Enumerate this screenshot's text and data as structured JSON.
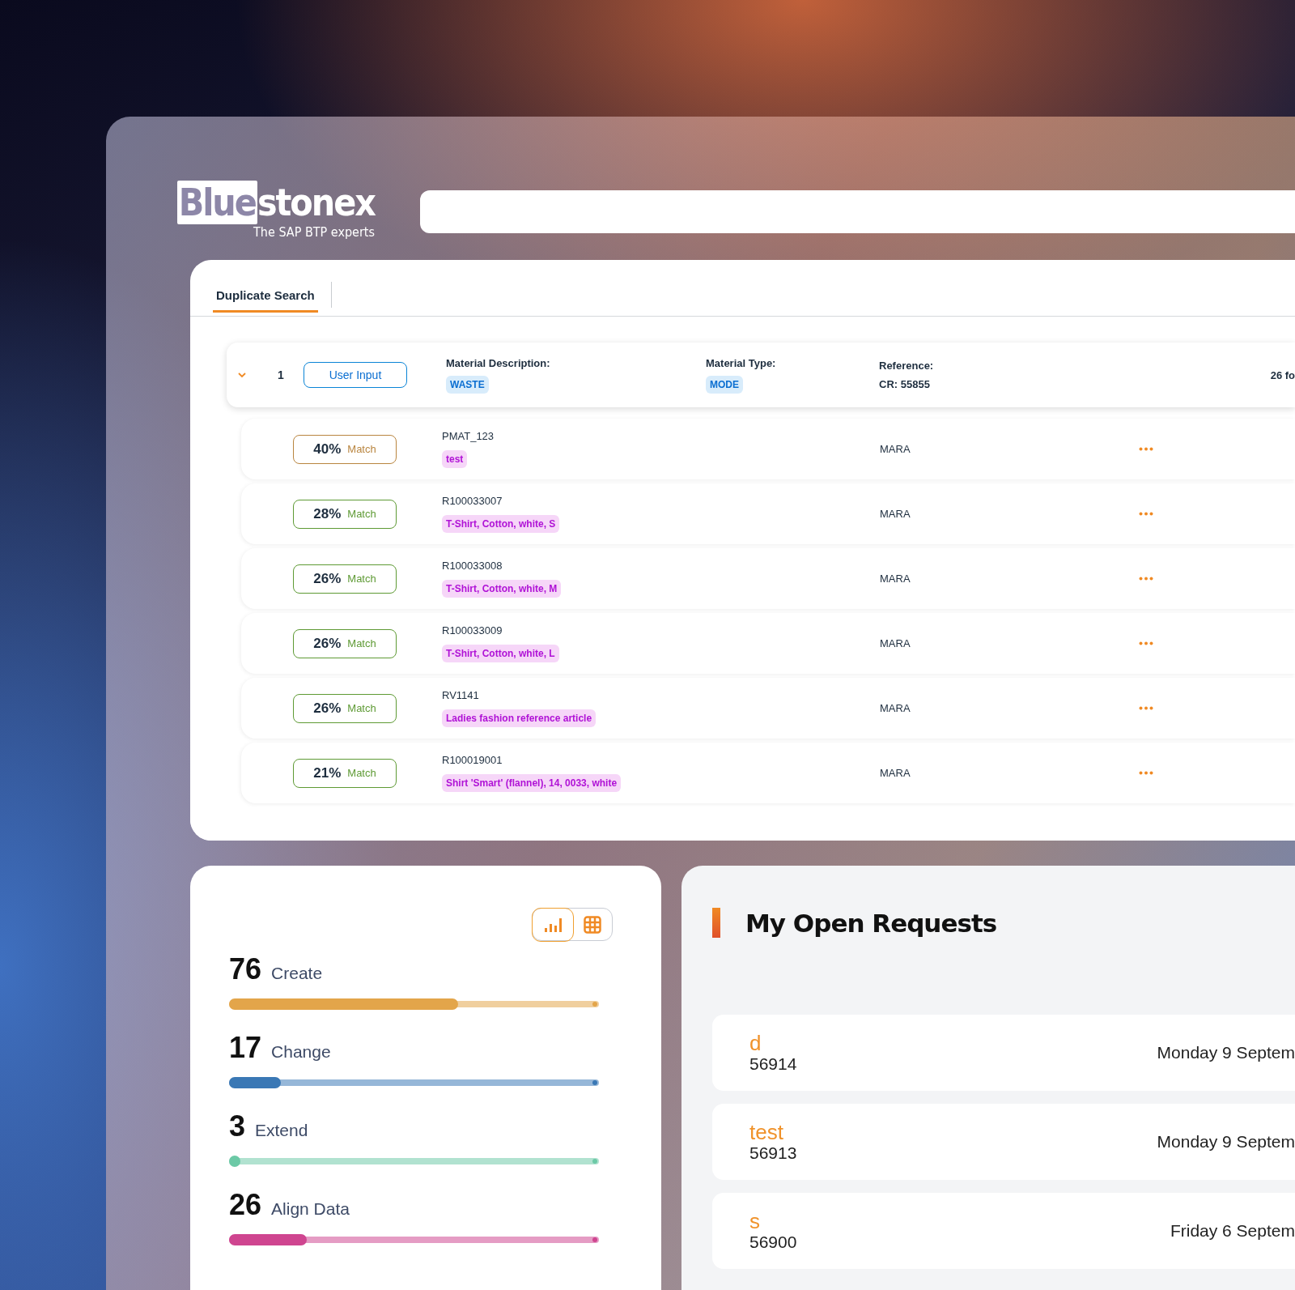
{
  "logo": {
    "name_highlight": "Blue",
    "name_rest": "stonex",
    "tagline": "The SAP BTP experts"
  },
  "tabs": [
    {
      "label": "Duplicate Search",
      "selected": true
    }
  ],
  "input_row": {
    "expanded": true,
    "number": "1",
    "button": "User Input",
    "description_label": "Material Description:",
    "description_tag": "WASTE",
    "type_label": "Material Type:",
    "type_tag": "MODE",
    "reference_label": "Reference:",
    "reference_value": "CR: 55855",
    "count": "26 fo"
  },
  "matches": [
    {
      "percent": "40%",
      "match_label": "Match",
      "color": "#b9853f",
      "id": "PMAT_123",
      "description": "test",
      "table": "MARA"
    },
    {
      "percent": "28%",
      "match_label": "Match",
      "color": "#5e9a34",
      "id": "R100033007",
      "description": "T-Shirt, Cotton, white, S",
      "table": "MARA"
    },
    {
      "percent": "26%",
      "match_label": "Match",
      "color": "#5e9a34",
      "id": "R100033008",
      "description": "T-Shirt, Cotton, white, M",
      "table": "MARA"
    },
    {
      "percent": "26%",
      "match_label": "Match",
      "color": "#5e9a34",
      "id": "R100033009",
      "description": "T-Shirt, Cotton, white, L",
      "table": "MARA"
    },
    {
      "percent": "26%",
      "match_label": "Match",
      "color": "#5e9a34",
      "id": "RV1141",
      "description": "Ladies fashion reference article",
      "table": "MARA"
    },
    {
      "percent": "21%",
      "match_label": "Match",
      "color": "#5e9a34",
      "id": "R100019001",
      "description": "Shirt 'Smart' (flannel), 14, 0033, white",
      "table": "MARA"
    }
  ],
  "view_toggle": [
    {
      "kind": "chart",
      "selected": true
    },
    {
      "kind": "table",
      "selected": false
    }
  ],
  "stats": [
    {
      "count": "76",
      "label": "Create",
      "level": 0.62,
      "color": "#e3a54a"
    },
    {
      "count": "17",
      "label": "Change",
      "level": 0.14,
      "color": "#3a78b5"
    },
    {
      "count": "3",
      "label": "Extend",
      "level": 0.02,
      "color": "#6cc9a6"
    },
    {
      "count": "26",
      "label": "Align Data",
      "level": 0.21,
      "color": "#cf4590"
    }
  ],
  "open_requests": {
    "title": "My Open Requests",
    "items": [
      {
        "name": "d",
        "id": "56914",
        "date": "Monday 9 Septem"
      },
      {
        "name": "test",
        "id": "56913",
        "date": "Monday 9 Septem"
      },
      {
        "name": "s",
        "id": "56900",
        "date": "Friday 6 Septem"
      }
    ]
  }
}
